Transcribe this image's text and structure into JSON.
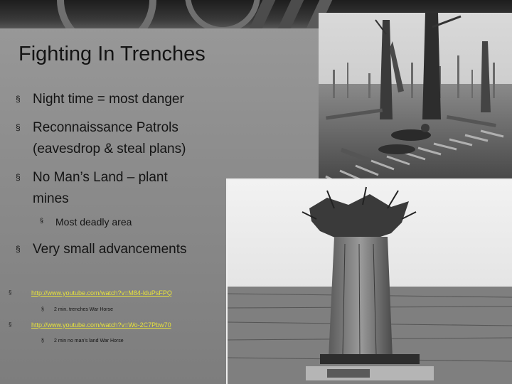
{
  "slide": {
    "title": "Fighting In Trenches",
    "bullets": [
      {
        "marker": "§",
        "lines": [
          "Night time =  most danger"
        ]
      },
      {
        "marker": "§",
        "lines": [
          "Reconnaissance Patrols",
          "(eavesdrop & steal plans)"
        ]
      },
      {
        "marker": "§",
        "lines": [
          "No Man’s Land – plant",
          "mines"
        ]
      },
      {
        "marker": "§",
        "lines": [
          "Very small advancements"
        ]
      }
    ],
    "sub_bullet": {
      "marker": "§",
      "text": "Most deadly area"
    },
    "links": [
      {
        "marker": "§",
        "url": "http://www.youtube.com/watch?v=M84-lduPsFPQ",
        "caption_marker": "§",
        "caption": "2 min. trenches War Horse"
      },
      {
        "marker": "§",
        "url": "http://www.youtube.com/watch?v=Wo-2C7Pbw70",
        "caption_marker": "§",
        "caption": "2 min no man’s land War Horse"
      }
    ],
    "link_color": "#e8e33a"
  },
  "images": {
    "photo_top": "battlefield-duckboards-photo",
    "photo_bottom": "tree-observation-post-photo"
  }
}
